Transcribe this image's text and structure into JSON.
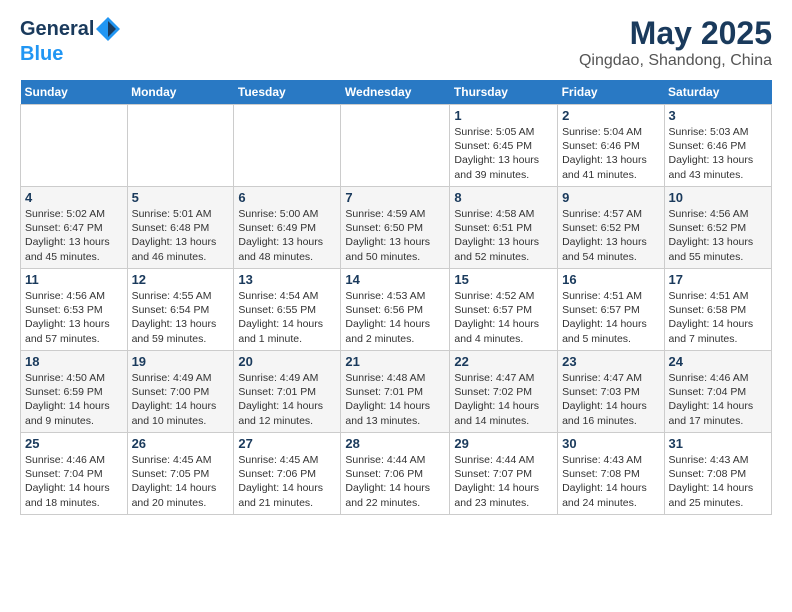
{
  "header": {
    "logo_line1": "General",
    "logo_line2": "Blue",
    "title": "May 2025",
    "subtitle": "Qingdao, Shandong, China"
  },
  "columns": [
    "Sunday",
    "Monday",
    "Tuesday",
    "Wednesday",
    "Thursday",
    "Friday",
    "Saturday"
  ],
  "weeks": [
    [
      {
        "day": "",
        "info": ""
      },
      {
        "day": "",
        "info": ""
      },
      {
        "day": "",
        "info": ""
      },
      {
        "day": "",
        "info": ""
      },
      {
        "day": "1",
        "info": "Sunrise: 5:05 AM\nSunset: 6:45 PM\nDaylight: 13 hours\nand 39 minutes."
      },
      {
        "day": "2",
        "info": "Sunrise: 5:04 AM\nSunset: 6:46 PM\nDaylight: 13 hours\nand 41 minutes."
      },
      {
        "day": "3",
        "info": "Sunrise: 5:03 AM\nSunset: 6:46 PM\nDaylight: 13 hours\nand 43 minutes."
      }
    ],
    [
      {
        "day": "4",
        "info": "Sunrise: 5:02 AM\nSunset: 6:47 PM\nDaylight: 13 hours\nand 45 minutes."
      },
      {
        "day": "5",
        "info": "Sunrise: 5:01 AM\nSunset: 6:48 PM\nDaylight: 13 hours\nand 46 minutes."
      },
      {
        "day": "6",
        "info": "Sunrise: 5:00 AM\nSunset: 6:49 PM\nDaylight: 13 hours\nand 48 minutes."
      },
      {
        "day": "7",
        "info": "Sunrise: 4:59 AM\nSunset: 6:50 PM\nDaylight: 13 hours\nand 50 minutes."
      },
      {
        "day": "8",
        "info": "Sunrise: 4:58 AM\nSunset: 6:51 PM\nDaylight: 13 hours\nand 52 minutes."
      },
      {
        "day": "9",
        "info": "Sunrise: 4:57 AM\nSunset: 6:52 PM\nDaylight: 13 hours\nand 54 minutes."
      },
      {
        "day": "10",
        "info": "Sunrise: 4:56 AM\nSunset: 6:52 PM\nDaylight: 13 hours\nand 55 minutes."
      }
    ],
    [
      {
        "day": "11",
        "info": "Sunrise: 4:56 AM\nSunset: 6:53 PM\nDaylight: 13 hours\nand 57 minutes."
      },
      {
        "day": "12",
        "info": "Sunrise: 4:55 AM\nSunset: 6:54 PM\nDaylight: 13 hours\nand 59 minutes."
      },
      {
        "day": "13",
        "info": "Sunrise: 4:54 AM\nSunset: 6:55 PM\nDaylight: 14 hours\nand 1 minute."
      },
      {
        "day": "14",
        "info": "Sunrise: 4:53 AM\nSunset: 6:56 PM\nDaylight: 14 hours\nand 2 minutes."
      },
      {
        "day": "15",
        "info": "Sunrise: 4:52 AM\nSunset: 6:57 PM\nDaylight: 14 hours\nand 4 minutes."
      },
      {
        "day": "16",
        "info": "Sunrise: 4:51 AM\nSunset: 6:57 PM\nDaylight: 14 hours\nand 5 minutes."
      },
      {
        "day": "17",
        "info": "Sunrise: 4:51 AM\nSunset: 6:58 PM\nDaylight: 14 hours\nand 7 minutes."
      }
    ],
    [
      {
        "day": "18",
        "info": "Sunrise: 4:50 AM\nSunset: 6:59 PM\nDaylight: 14 hours\nand 9 minutes."
      },
      {
        "day": "19",
        "info": "Sunrise: 4:49 AM\nSunset: 7:00 PM\nDaylight: 14 hours\nand 10 minutes."
      },
      {
        "day": "20",
        "info": "Sunrise: 4:49 AM\nSunset: 7:01 PM\nDaylight: 14 hours\nand 12 minutes."
      },
      {
        "day": "21",
        "info": "Sunrise: 4:48 AM\nSunset: 7:01 PM\nDaylight: 14 hours\nand 13 minutes."
      },
      {
        "day": "22",
        "info": "Sunrise: 4:47 AM\nSunset: 7:02 PM\nDaylight: 14 hours\nand 14 minutes."
      },
      {
        "day": "23",
        "info": "Sunrise: 4:47 AM\nSunset: 7:03 PM\nDaylight: 14 hours\nand 16 minutes."
      },
      {
        "day": "24",
        "info": "Sunrise: 4:46 AM\nSunset: 7:04 PM\nDaylight: 14 hours\nand 17 minutes."
      }
    ],
    [
      {
        "day": "25",
        "info": "Sunrise: 4:46 AM\nSunset: 7:04 PM\nDaylight: 14 hours\nand 18 minutes."
      },
      {
        "day": "26",
        "info": "Sunrise: 4:45 AM\nSunset: 7:05 PM\nDaylight: 14 hours\nand 20 minutes."
      },
      {
        "day": "27",
        "info": "Sunrise: 4:45 AM\nSunset: 7:06 PM\nDaylight: 14 hours\nand 21 minutes."
      },
      {
        "day": "28",
        "info": "Sunrise: 4:44 AM\nSunset: 7:06 PM\nDaylight: 14 hours\nand 22 minutes."
      },
      {
        "day": "29",
        "info": "Sunrise: 4:44 AM\nSunset: 7:07 PM\nDaylight: 14 hours\nand 23 minutes."
      },
      {
        "day": "30",
        "info": "Sunrise: 4:43 AM\nSunset: 7:08 PM\nDaylight: 14 hours\nand 24 minutes."
      },
      {
        "day": "31",
        "info": "Sunrise: 4:43 AM\nSunset: 7:08 PM\nDaylight: 14 hours\nand 25 minutes."
      }
    ]
  ]
}
